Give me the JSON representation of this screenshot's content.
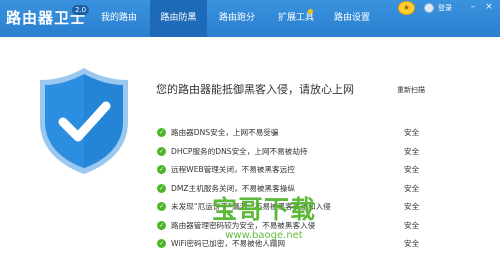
{
  "app": {
    "title": "路由器卫士",
    "version": "2.0"
  },
  "nav": {
    "tabs": [
      {
        "label": "我的路由"
      },
      {
        "label": "路由防黑"
      },
      {
        "label": "路由跑分"
      },
      {
        "label": "扩展工具"
      },
      {
        "label": "路由设置"
      }
    ],
    "active_tab": "路由防黑"
  },
  "header_right": {
    "gift_glyph": "★",
    "login_label": "登录",
    "minimize": "–",
    "close": "×"
  },
  "colors": {
    "accent": "#2a7fcf",
    "active_tab": "#1e6ab9",
    "safe_green": "#4fb528",
    "shield": "#2b8ee0"
  },
  "main": {
    "headline": "您的路由器能抵御黑客入侵，请放心上网",
    "rescan_label": "重新扫描",
    "items": [
      {
        "label": "路由器DNS安全，上网不易受骗",
        "status": "安全"
      },
      {
        "label": "DHCP服务的DNS安全，上网不易被劫持",
        "status": "安全"
      },
      {
        "label": "远程WEB管理关闭，不易被黑客远控",
        "status": "安全"
      },
      {
        "label": "DMZ主机服务关闭，不易被黑客操纵",
        "status": "安全"
      },
      {
        "label": "未发现“厄运饼干”漏洞，不易被黑客攻击和入侵",
        "status": "安全"
      },
      {
        "label": "路由器管理密码较为安全，不易被黑客入侵",
        "status": "安全"
      },
      {
        "label": "WiFi密码已加密，不易被他人蹭网",
        "status": "安全"
      }
    ]
  },
  "watermark": {
    "title": "宝哥下载",
    "url": "www.baoge.net"
  }
}
